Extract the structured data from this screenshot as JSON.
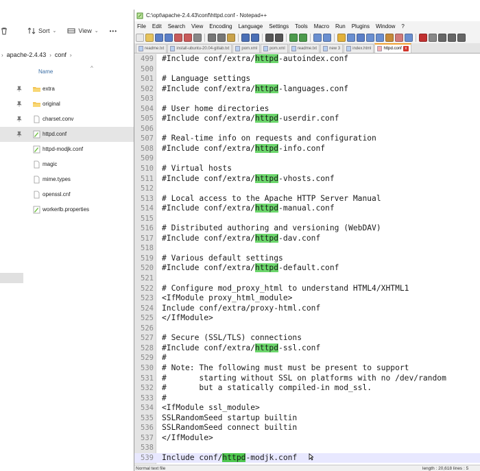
{
  "explorer": {
    "toolbar": {
      "sort_label": "Sort",
      "view_label": "View",
      "more_label": "•••"
    },
    "breadcrumb": [
      "apache-2.4.43",
      "conf"
    ],
    "column_header": "Name",
    "items": [
      {
        "label": "extra",
        "icon": "folder-icon",
        "pinned": true
      },
      {
        "label": "original",
        "icon": "folder-icon",
        "pinned": true
      },
      {
        "label": "charset.conv",
        "icon": "file-icon",
        "pinned": true
      },
      {
        "label": "httpd.conf",
        "icon": "notepadpp-file-icon",
        "pinned": true,
        "selected": true
      },
      {
        "label": "httpd-modjk.conf",
        "icon": "notepadpp-file-icon"
      },
      {
        "label": "magic",
        "icon": "file-icon"
      },
      {
        "label": "mime.types",
        "icon": "file-icon"
      },
      {
        "label": "openssl.cnf",
        "icon": "file-icon"
      },
      {
        "label": "workerlb.properties",
        "icon": "notepadpp-file-icon"
      }
    ]
  },
  "npp": {
    "title": "C:\\opt\\apache-2.4.43\\conf\\httpd.conf - Notepad++",
    "menu": [
      "File",
      "Edit",
      "Search",
      "View",
      "Encoding",
      "Language",
      "Settings",
      "Tools",
      "Macro",
      "Run",
      "Plugins",
      "Window",
      "?"
    ],
    "tabs": [
      {
        "label": "readme.txt"
      },
      {
        "label": "install-ubuntu-20.04-gitlab.txt"
      },
      {
        "label": "pom.xml"
      },
      {
        "label": "pom.xml"
      },
      {
        "label": "readme.txt"
      },
      {
        "label": "new 3"
      },
      {
        "label": "index.html"
      },
      {
        "label": "httpd.conf",
        "active": true
      }
    ],
    "lines": [
      {
        "n": "499",
        "pre": "#Include conf/extra/",
        "hl": "httpd",
        "post": "-autoindex.conf"
      },
      {
        "n": "500",
        "pre": "",
        "hl": "",
        "post": ""
      },
      {
        "n": "501",
        "pre": "# Language settings",
        "hl": "",
        "post": ""
      },
      {
        "n": "502",
        "pre": "#Include conf/extra/",
        "hl": "httpd",
        "post": "-languages.conf"
      },
      {
        "n": "503",
        "pre": "",
        "hl": "",
        "post": ""
      },
      {
        "n": "504",
        "pre": "# User home directories",
        "hl": "",
        "post": ""
      },
      {
        "n": "505",
        "pre": "#Include conf/extra/",
        "hl": "httpd",
        "post": "-userdir.conf"
      },
      {
        "n": "506",
        "pre": "",
        "hl": "",
        "post": ""
      },
      {
        "n": "507",
        "pre": "# Real-time info on requests and configuration",
        "hl": "",
        "post": ""
      },
      {
        "n": "508",
        "pre": "#Include conf/extra/",
        "hl": "httpd",
        "post": "-info.conf"
      },
      {
        "n": "509",
        "pre": "",
        "hl": "",
        "post": ""
      },
      {
        "n": "510",
        "pre": "# Virtual hosts",
        "hl": "",
        "post": ""
      },
      {
        "n": "511",
        "pre": "#Include conf/extra/",
        "hl": "httpd",
        "post": "-vhosts.conf"
      },
      {
        "n": "512",
        "pre": "",
        "hl": "",
        "post": ""
      },
      {
        "n": "513",
        "pre": "# Local access to the Apache HTTP Server Manual",
        "hl": "",
        "post": ""
      },
      {
        "n": "514",
        "pre": "#Include conf/extra/",
        "hl": "httpd",
        "post": "-manual.conf"
      },
      {
        "n": "515",
        "pre": "",
        "hl": "",
        "post": ""
      },
      {
        "n": "516",
        "pre": "# Distributed authoring and versioning (WebDAV)",
        "hl": "",
        "post": ""
      },
      {
        "n": "517",
        "pre": "#Include conf/extra/",
        "hl": "httpd",
        "post": "-dav.conf"
      },
      {
        "n": "518",
        "pre": "",
        "hl": "",
        "post": ""
      },
      {
        "n": "519",
        "pre": "# Various default settings",
        "hl": "",
        "post": ""
      },
      {
        "n": "520",
        "pre": "#Include conf/extra/",
        "hl": "httpd",
        "post": "-default.conf"
      },
      {
        "n": "521",
        "pre": "",
        "hl": "",
        "post": ""
      },
      {
        "n": "522",
        "pre": "# Configure mod_proxy_html to understand HTML4/XHTML1",
        "hl": "",
        "post": ""
      },
      {
        "n": "523",
        "pre": "<IfModule proxy_html_module>",
        "hl": "",
        "post": ""
      },
      {
        "n": "524",
        "pre": "Include conf/extra/proxy-html.conf",
        "hl": "",
        "post": ""
      },
      {
        "n": "525",
        "pre": "</IfModule>",
        "hl": "",
        "post": ""
      },
      {
        "n": "526",
        "pre": "",
        "hl": "",
        "post": ""
      },
      {
        "n": "527",
        "pre": "# Secure (SSL/TLS) connections",
        "hl": "",
        "post": ""
      },
      {
        "n": "528",
        "pre": "#Include conf/extra/",
        "hl": "httpd",
        "post": "-ssl.conf"
      },
      {
        "n": "529",
        "pre": "#",
        "hl": "",
        "post": ""
      },
      {
        "n": "530",
        "pre": "# Note: The following must must be present to support",
        "hl": "",
        "post": ""
      },
      {
        "n": "531",
        "pre": "#       starting without SSL on platforms with no /dev/random",
        "hl": "",
        "post": ""
      },
      {
        "n": "532",
        "pre": "#       but a statically compiled-in mod_ssl.",
        "hl": "",
        "post": ""
      },
      {
        "n": "533",
        "pre": "#",
        "hl": "",
        "post": ""
      },
      {
        "n": "534",
        "pre": "<IfModule ssl_module>",
        "hl": "",
        "post": ""
      },
      {
        "n": "535",
        "pre": "SSLRandomSeed startup builtin",
        "hl": "",
        "post": ""
      },
      {
        "n": "536",
        "pre": "SSLRandomSeed connect builtin",
        "hl": "",
        "post": ""
      },
      {
        "n": "537",
        "pre": "</IfModule>",
        "hl": "",
        "post": ""
      },
      {
        "n": "538",
        "pre": "",
        "hl": "",
        "post": ""
      },
      {
        "n": "539",
        "pre": "Include conf/",
        "hl": "httpd",
        "post": "-modjk.conf",
        "current": true
      }
    ],
    "status": {
      "left": "Normal text file",
      "right": "length : 20,618    lines : 5"
    }
  },
  "colors": {
    "highlight": "#6cd66c",
    "current_line": "#e8e8ff",
    "active_tab_accent": "#f0a030"
  }
}
